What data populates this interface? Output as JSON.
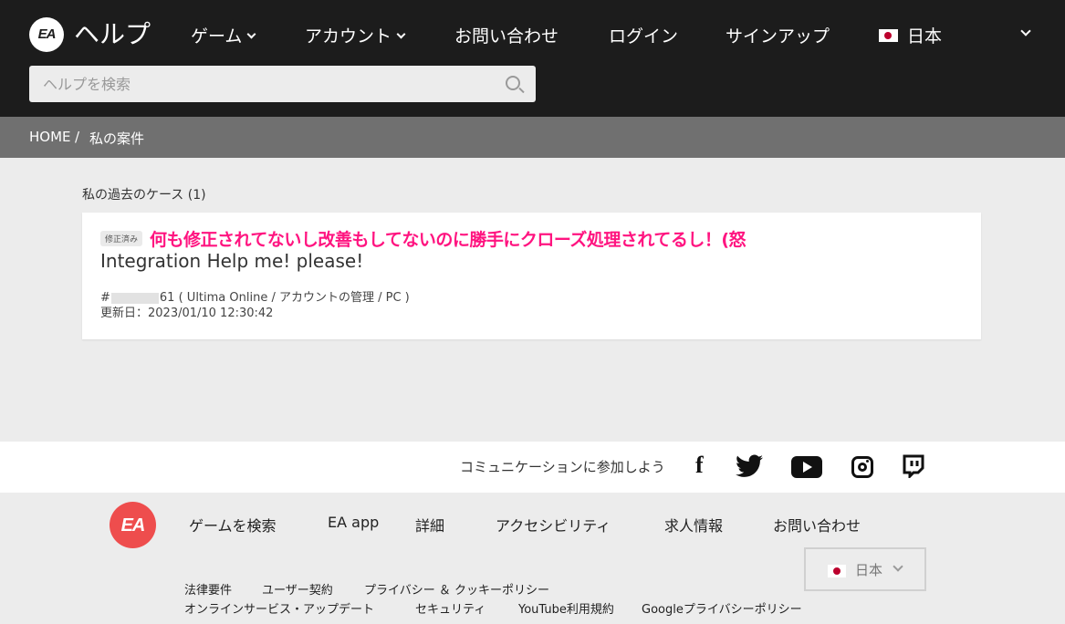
{
  "header": {
    "logo_text": "EA",
    "title": "ヘルプ",
    "nav": {
      "games": "ゲーム",
      "account": "アカウント",
      "contact": "お問い合わせ",
      "login": "ログイン",
      "signup": "サインアップ",
      "language": "日本"
    },
    "search": {
      "placeholder": "ヘルプを検索",
      "value": ""
    }
  },
  "breadcrumb": {
    "home": "HOME",
    "separator": "/",
    "current": "私の案件"
  },
  "main": {
    "section_title": "私の過去のケース (1)",
    "case": {
      "badge": "修正済み",
      "overlay_comment": "何も修正されてないし改善もしてないのに勝手にクローズ処理されてるし！(怒",
      "title": "Integration Help me! please!",
      "id_prefix": "#",
      "id_suffix": "61",
      "details": "( Ultima Online / アカウントの管理 / PC )",
      "updated": "更新日：2023/01/10 12:30:42"
    }
  },
  "social": {
    "label": "コミュニケーションに参加しよう",
    "facebook_glyph": "f",
    "icons": [
      "facebook-icon",
      "twitter-icon",
      "youtube-icon",
      "instagram-icon",
      "twitch-icon"
    ]
  },
  "footer": {
    "logo_text": "EA",
    "links": {
      "search_games": "ゲームを検索",
      "ea_app": "EA app",
      "details": "詳細",
      "accessibility": "アクセシビリティ",
      "jobs": "求人情報",
      "contact": "お問い合わせ"
    },
    "language_select": "日本",
    "legal": {
      "legal_requirements": "法律要件",
      "user_agreement": "ユーザー契約",
      "privacy_cookie": "プライバシー ＆ クッキーポリシー",
      "online_service_updates": "オンラインサービス・アップデート",
      "security": "セキュリティ",
      "youtube_terms": "YouTube利用規約",
      "google_privacy": "Googleプライバシーポリシー"
    }
  },
  "colors": {
    "header_bg": "#1c1c1c",
    "breadcrumb_bg": "#707070",
    "overlay_text": "#ff1480",
    "footer_logo": "#ee4d4d"
  }
}
